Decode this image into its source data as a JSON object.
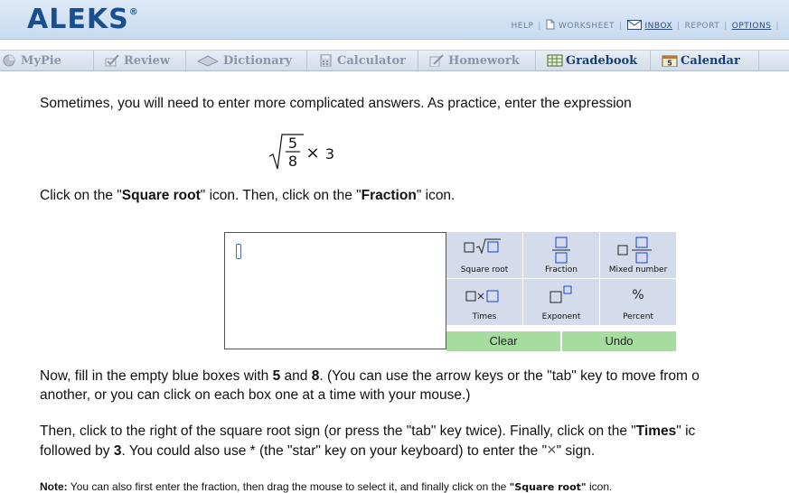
{
  "header": {
    "logo": "ALEKS",
    "logo_mark": "®",
    "links": [
      {
        "label": "HELP",
        "underlined": false
      },
      {
        "label": "WORKSHEET",
        "underlined": false,
        "icon": "document-icon"
      },
      {
        "label": "INBOX",
        "underlined": true,
        "icon": "envelope-icon"
      },
      {
        "label": "REPORT",
        "underlined": false
      },
      {
        "label": "OPTIONS",
        "underlined": true
      }
    ]
  },
  "tabs": [
    {
      "label": "MyPie",
      "icon": "pie-icon",
      "active": false
    },
    {
      "label": "Review",
      "icon": "checkmark-icon",
      "active": false
    },
    {
      "label": "Dictionary",
      "icon": "book-icon",
      "active": false
    },
    {
      "label": "Calculator",
      "icon": "calculator-icon",
      "active": false
    },
    {
      "label": "Homework",
      "icon": "pencil-paper-icon",
      "active": false
    },
    {
      "label": "Gradebook",
      "icon": "gradebook-icon",
      "active": true
    },
    {
      "label": "Calendar",
      "icon": "calendar-icon",
      "active": true
    }
  ],
  "content": {
    "intro": "Sometimes, you will need to enter more complicated answers. As practice, enter the expression",
    "expression": {
      "numerator": "5",
      "denominator": "8",
      "operator": "×",
      "multiplier": "3"
    },
    "instruction1": {
      "pre": "Click on the \"",
      "b1": "Square root",
      "mid": "\" icon. Then, click on the \"",
      "b2": "Fraction",
      "post": "\" icon."
    },
    "instruction2": {
      "pre": "Now, fill in the empty blue boxes with ",
      "b1": "5",
      "mid": " and ",
      "b2": "8",
      "post": ". (You can use the arrow keys or the \"tab\" key to move from o",
      "line2": "another, or you can click on each box one at a time with your mouse.)"
    },
    "instruction3": {
      "pre": "Then, click to the right of the square root sign (or press the \"tab\" key twice). Finally, click on the \"",
      "b1": "Times",
      "post": "\" ic",
      "line2_pre": "followed by ",
      "line2_b": "3",
      "line2_mid": ". You could also use * (the \"star\" key on your keyboard) to enter the \"",
      "line2_sym": "×",
      "line2_post": "\" sign."
    },
    "note": {
      "label": "Note:",
      "text": " You can also first enter the fraction, then drag the mouse to select it, and finally click on the ",
      "bold": "\"Square root\"",
      "end": " icon."
    }
  },
  "palette": {
    "buttons": [
      {
        "label": "Square root",
        "icon": "square-root-icon"
      },
      {
        "label": "Fraction",
        "icon": "fraction-icon"
      },
      {
        "label": "Mixed number",
        "icon": "mixed-number-icon"
      },
      {
        "label": "Times",
        "icon": "times-icon"
      },
      {
        "label": "Exponent",
        "icon": "exponent-icon"
      },
      {
        "label": "Percent",
        "icon": "percent-icon",
        "glyph": "%"
      }
    ],
    "clear_label": "Clear",
    "undo_label": "Undo"
  },
  "colors": {
    "logo": "#1a4f8f",
    "palette_bg": "#d4dcec",
    "action_bg": "#a6dca0",
    "input_box_blue": "#1a3fd6"
  }
}
